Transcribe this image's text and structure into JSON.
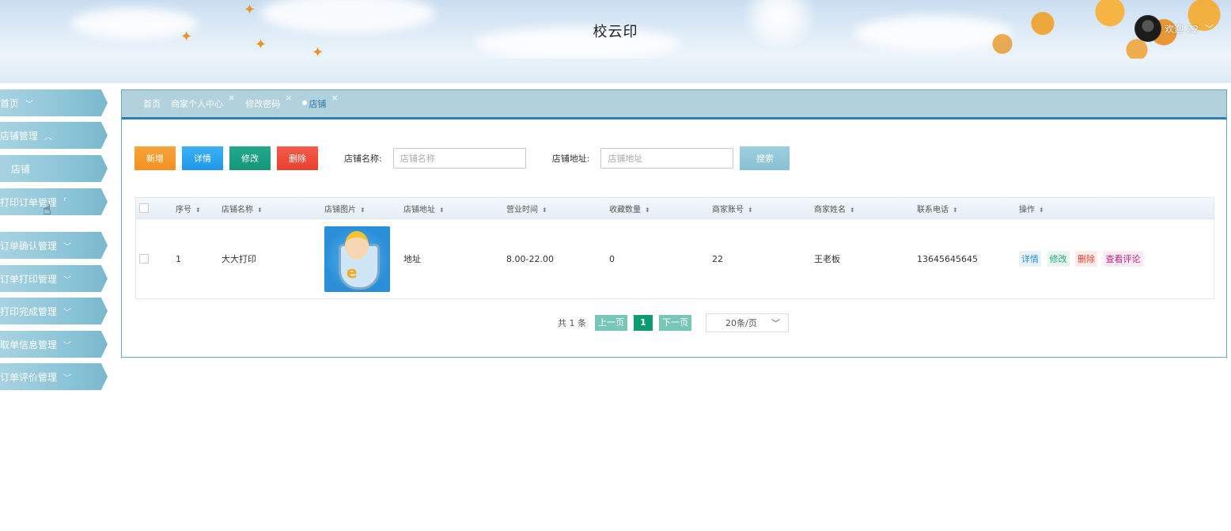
{
  "header": {
    "title": "校云印",
    "welcome": "欢迎 22"
  },
  "sidebar": {
    "items": [
      {
        "label": "首页"
      },
      {
        "label": "店铺管理"
      },
      {
        "label": "店铺"
      },
      {
        "label": "打印订单管理"
      },
      {
        "label": "订单确认管理"
      },
      {
        "label": "订单打印管理"
      },
      {
        "label": "打印完成管理"
      },
      {
        "label": "取单信息管理"
      },
      {
        "label": "订单评价管理"
      }
    ]
  },
  "tabs": [
    {
      "label": "首页"
    },
    {
      "label": "商家个人中心"
    },
    {
      "label": "修改密码"
    },
    {
      "label": "店铺"
    }
  ],
  "toolbar": {
    "add": "新增",
    "detail": "详情",
    "edit": "修改",
    "delete": "删除",
    "name_label": "店铺名称:",
    "name_placeholder": "店铺名称",
    "address_label": "店铺地址:",
    "address_placeholder": "店铺地址",
    "search": "搜索"
  },
  "table": {
    "columns": [
      "序号",
      "店铺名称",
      "店铺图片",
      "店铺地址",
      "营业时间",
      "收藏数量",
      "商家账号",
      "商家姓名",
      "联系电话",
      "操作"
    ],
    "rows": [
      {
        "index": "1",
        "name": "大大打印",
        "address": "地址",
        "hours": "8.00-22.00",
        "favorites": "0",
        "account": "22",
        "owner": "王老板",
        "phone": "13645645645"
      }
    ],
    "row_actions": {
      "detail": "详情",
      "edit": "修改",
      "delete": "删除",
      "review": "查看评论"
    }
  },
  "pager": {
    "total": "共 1 条",
    "prev": "上一页",
    "current": "1",
    "next": "下一页",
    "page_size": "20条/页"
  }
}
